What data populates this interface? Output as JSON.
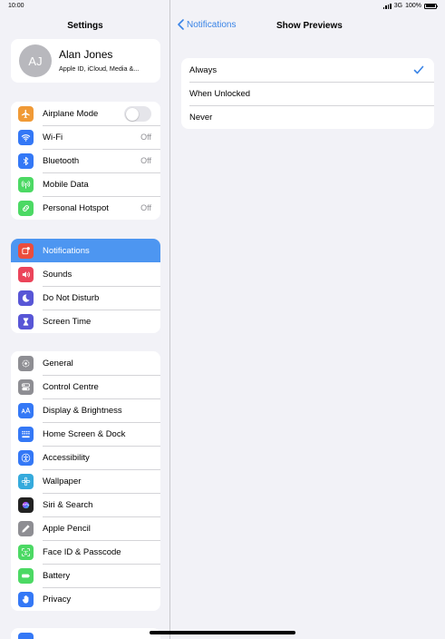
{
  "status": {
    "time": "10:00",
    "network": "3G",
    "battery": "100%"
  },
  "sidebar": {
    "title": "Settings",
    "profile": {
      "initials": "AJ",
      "name": "Alan Jones",
      "subtitle": "Apple ID, iCloud, Media &..."
    },
    "group1": [
      {
        "label": "Airplane Mode",
        "icon": "airplane-icon",
        "color": "#f09a37",
        "toggle": false
      },
      {
        "label": "Wi-Fi",
        "icon": "wifi-icon",
        "color": "#3478f6",
        "value": "Off"
      },
      {
        "label": "Bluetooth",
        "icon": "bluetooth-icon",
        "color": "#3478f6",
        "value": "Off"
      },
      {
        "label": "Mobile Data",
        "icon": "antenna-icon",
        "color": "#4cd964"
      },
      {
        "label": "Personal Hotspot",
        "icon": "hotspot-icon",
        "color": "#4cd964",
        "value": "Off"
      }
    ],
    "group2": [
      {
        "label": "Notifications",
        "icon": "notifications-icon",
        "color": "#eb4d3d",
        "selected": true
      },
      {
        "label": "Sounds",
        "icon": "speaker-icon",
        "color": "#eb445a"
      },
      {
        "label": "Do Not Disturb",
        "icon": "moon-icon",
        "color": "#5856d6"
      },
      {
        "label": "Screen Time",
        "icon": "hourglass-icon",
        "color": "#5856d6"
      }
    ],
    "group3": [
      {
        "label": "General",
        "icon": "gear-icon",
        "color": "#8e8e93"
      },
      {
        "label": "Control Centre",
        "icon": "switches-icon",
        "color": "#8e8e93"
      },
      {
        "label": "Display & Brightness",
        "icon": "text-size-icon",
        "color": "#3478f6"
      },
      {
        "label": "Home Screen & Dock",
        "icon": "grid-icon",
        "color": "#3478f6"
      },
      {
        "label": "Accessibility",
        "icon": "accessibility-icon",
        "color": "#3478f6"
      },
      {
        "label": "Wallpaper",
        "icon": "flower-icon",
        "color": "#35aadc"
      },
      {
        "label": "Siri & Search",
        "icon": "siri-icon",
        "color": "#222222"
      },
      {
        "label": "Apple Pencil",
        "icon": "pencil-icon",
        "color": "#8e8e93"
      },
      {
        "label": "Face ID & Passcode",
        "icon": "face-id-icon",
        "color": "#4cd964"
      },
      {
        "label": "Battery",
        "icon": "battery-icon",
        "color": "#4cd964"
      },
      {
        "label": "Privacy",
        "icon": "hand-icon",
        "color": "#3478f6"
      }
    ]
  },
  "detail": {
    "back_label": "Notifications",
    "title": "Show Previews",
    "options": [
      {
        "label": "Always",
        "checked": true
      },
      {
        "label": "When Unlocked",
        "checked": false
      },
      {
        "label": "Never",
        "checked": false
      }
    ]
  },
  "colors": {
    "accent": "#3a84e6",
    "selected_row": "#4d96f1",
    "background": "#f2f2f7"
  }
}
